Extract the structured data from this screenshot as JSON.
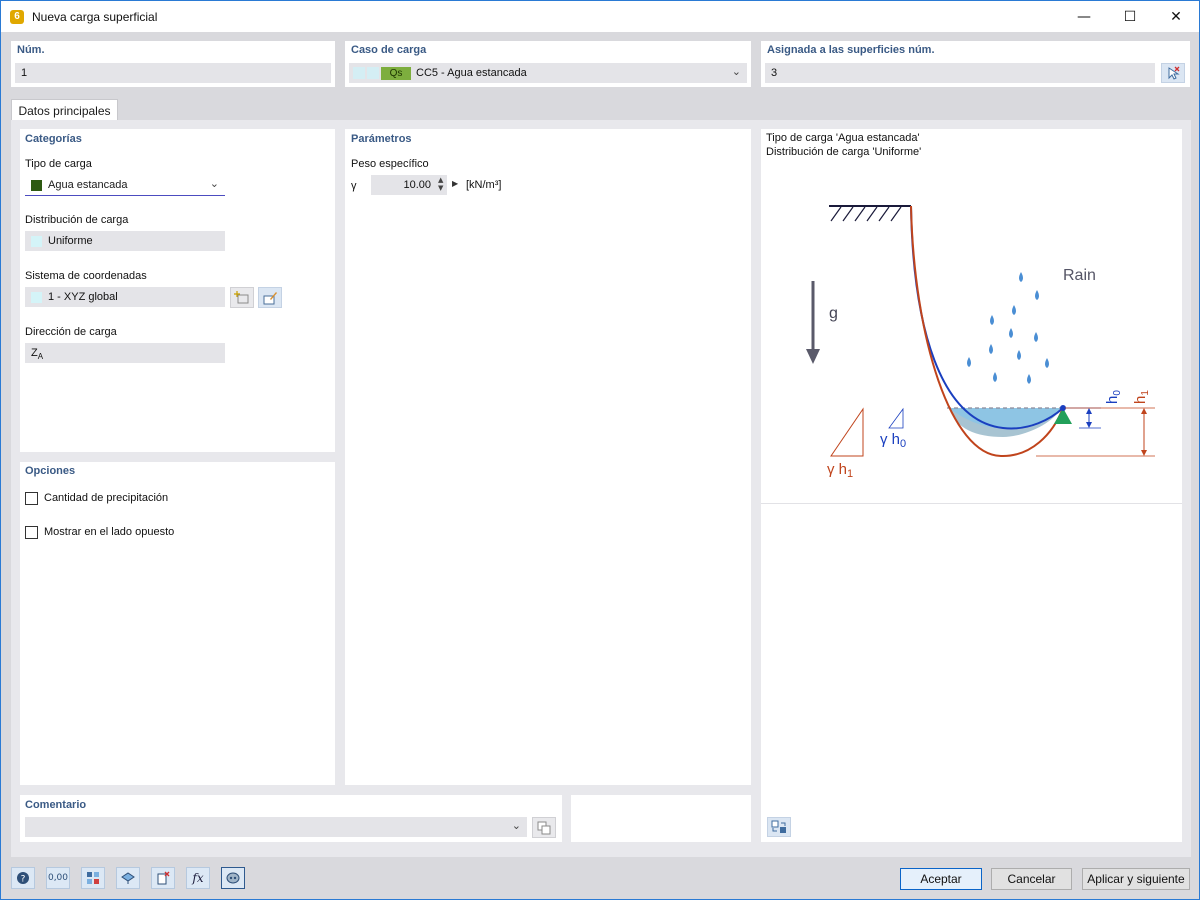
{
  "window": {
    "title": "Nueva carga superficial",
    "minimize_glyph": "—",
    "maximize_glyph": "☐",
    "close_glyph": "✕"
  },
  "top": {
    "num_label": "Núm.",
    "num_value": "1",
    "load_case_label": "Caso de carga",
    "load_case_tag": "Qs",
    "load_case_value": "CC5 - Agua estancada",
    "assigned_label": "Asignada a las superficies núm.",
    "assigned_value": "3"
  },
  "tabs": [
    {
      "label": "Datos principales"
    }
  ],
  "categories": {
    "header": "Categorías",
    "load_type_label": "Tipo de carga",
    "load_type_value": "Agua estancada",
    "load_type_color": "#2e5a12",
    "distribution_label": "Distribución de carga",
    "distribution_value": "Uniforme",
    "coord_system_label": "Sistema de coordenadas",
    "coord_system_value": "1 - XYZ global",
    "direction_label": "Dirección de carga",
    "direction_value_main": "Z",
    "direction_value_sub": "A"
  },
  "options": {
    "header": "Opciones",
    "precip_label": "Cantidad de precipitación",
    "opposite_label": "Mostrar en el lado opuesto"
  },
  "parameters": {
    "header": "Parámetros",
    "specific_weight_label": "Peso específico",
    "symbol": "γ",
    "value": "10.00",
    "unit": "[kN/m³]"
  },
  "preview": {
    "line1": "Tipo de carga 'Agua estancada'",
    "line2": "Distribución de carga 'Uniforme'",
    "rain_label": "Rain",
    "g_label": "g",
    "h0_label": "h",
    "h0_sub": "0",
    "h1_label": "h",
    "h1_sub": "1",
    "gamma_h0_main": "γ h",
    "gamma_h0_sub": "0",
    "gamma_h1_main": "γ h",
    "gamma_h1_sub": "1"
  },
  "comment": {
    "label": "Comentario",
    "value": ""
  },
  "buttons": {
    "accept": "Aceptar",
    "cancel": "Cancelar",
    "apply_next": "Aplicar y siguiente"
  },
  "toolbar_icons": [
    "help-icon",
    "units-icon",
    "model-info-icon",
    "view-icon",
    "delete-icon",
    "function-icon",
    "settings-icon"
  ],
  "toolbar_units_text": "0,00",
  "colors": {
    "header_text": "#3a5a85",
    "accent_blue": "#1a3fbf",
    "accent_red": "#c0441c",
    "water": "#9ecbe0",
    "support_green": "#22a05a"
  }
}
